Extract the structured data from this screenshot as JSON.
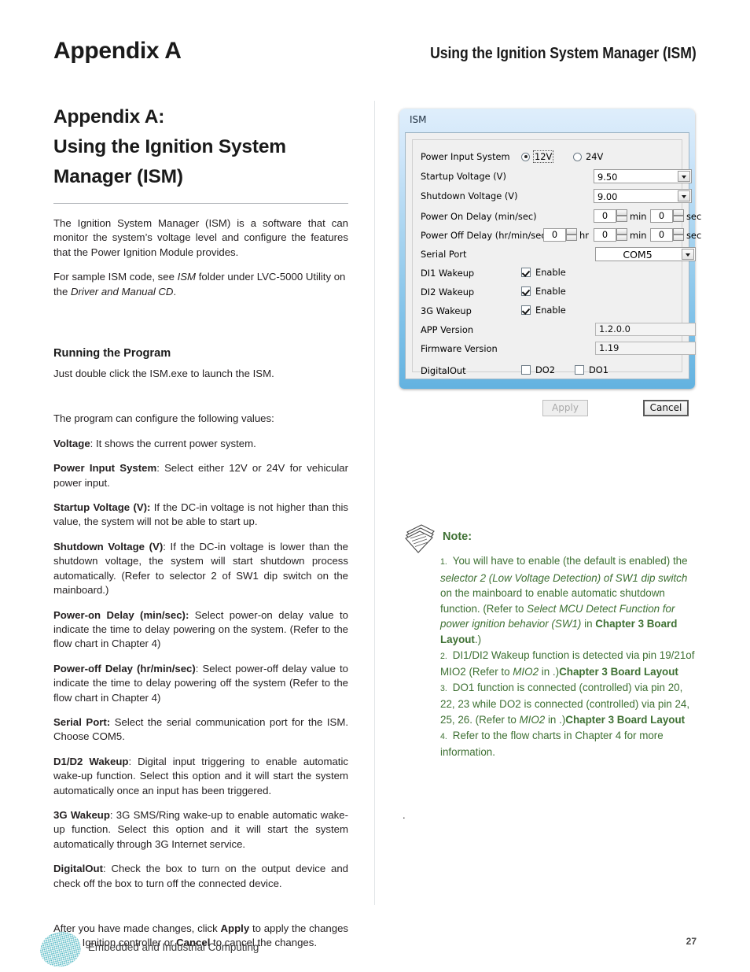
{
  "header": {
    "chapter_title": "Appendix A",
    "running_head": "Using the Ignition System Manager (ISM)"
  },
  "left_column": {
    "section_title_line1": "Appendix A:",
    "section_title_line2": "Using the Ignition System",
    "section_title_line3": "Manager (ISM)",
    "intro_paragraph": "The Ignition System Manager (ISM) is a software that can monitor the system’s voltage level and configure the features that the Power Ignition Module provides.",
    "sample_code_pre": "For sample ISM code, see ",
    "sample_code_em1": "ISM",
    "sample_code_mid": " folder under LVC-5000 Utility on the ",
    "sample_code_em2": "Driver and Manual CD",
    "sample_code_post": ".",
    "running_heading": "Running the Program",
    "running_text": "Just double click the ISM.exe to launch the ISM.",
    "configure_intro": "The program can configure the following values:",
    "definitions": [
      {
        "term": "Voltage",
        "sep": ": ",
        "text": "It shows the current power system."
      },
      {
        "term": "Power Input System",
        "sep": ": ",
        "text": "Select either 12V or 24V for vehicular power input."
      },
      {
        "term": "Startup Voltage (V):",
        "sep": "  ",
        "text": "If the DC-in voltage is not higher than this value, the system will not be able to start up."
      },
      {
        "term": "Shutdown Voltage (V)",
        "sep": ": ",
        "text": "If the DC-in voltage is lower than the shutdown voltage, the system will start shutdown process automatically. (Refer to selector 2 of SW1 dip switch on the mainboard.)"
      },
      {
        "term": "Power-on Delay (min/sec):",
        "sep": " ",
        "text": "Select power-on delay value to indicate the time to delay powering on the system. (Refer to the flow chart in Chapter 4)"
      },
      {
        "term": "Power-off Delay (hr/min/sec)",
        "sep": ": ",
        "text": "Select power-off delay value to indicate the time to delay powering off the system (Refer to the flow chart in Chapter 4)"
      },
      {
        "term": "Serial Port:",
        "sep": " ",
        "text": "Select the serial communication port for the ISM. Choose COM5."
      },
      {
        "term": "D1/D2 Wakeup",
        "sep": ": ",
        "text": "Digital input triggering to enable automatic wake-up function. Select this option and it will start the system automatically once an input has been triggered."
      },
      {
        "term": "3G Wakeup",
        "sep": ": ",
        "text": "3G SMS/Ring wake-up to enable automatic wake-up function.  Select this option and it will start the system automatically through 3G Internet service."
      },
      {
        "term": "DigitalOut",
        "sep": ":  ",
        "text": "Check the box to turn on the output device and check off the box to turn off the connected device."
      }
    ],
    "closing_pre": "After you have made changes, click ",
    "closing_b1": "Apply",
    "closing_mid": " to apply the changes to the Ignition controller or ",
    "closing_b2": "Cancel",
    "closing_post": " to cancel the changes."
  },
  "ism_dialog": {
    "title": "ISM",
    "rows": {
      "power_input_label": "Power Input System",
      "radio_12v": "12V",
      "radio_24v": "24V",
      "startup_voltage_label": "Startup Voltage (V)",
      "startup_voltage_value": "9.50",
      "shutdown_voltage_label": "Shutdown Voltage (V)",
      "shutdown_voltage_value": "9.00",
      "power_on_delay_label": "Power On Delay (min/sec)",
      "power_on_min": "0",
      "power_on_min_unit": "min",
      "power_on_sec": "0",
      "power_on_sec_unit": "sec",
      "power_off_delay_label": "Power Off Delay (hr/min/sec)",
      "power_off_hr": "0",
      "power_off_hr_unit": "hr",
      "power_off_min": "0",
      "power_off_min_unit": "min",
      "power_off_sec": "0",
      "power_off_sec_unit": "sec",
      "serial_port_label": "Serial Port",
      "serial_port_value": "COM5",
      "di1_wakeup_label": "DI1 Wakeup",
      "di1_wakeup_enable": "Enable",
      "di2_wakeup_label": "DI2 Wakeup",
      "di2_wakeup_enable": "Enable",
      "g3_wakeup_label": "3G Wakeup",
      "g3_wakeup_enable": "Enable",
      "app_version_label": "APP Version",
      "app_version_value": "1.2.0.0",
      "firmware_version_label": "Firmware Version",
      "firmware_version_value": "1.19",
      "digitalout_label": "DigitalOut",
      "do2_label": "DO2",
      "do1_label": "DO1"
    },
    "buttons": {
      "apply": "Apply",
      "cancel": "Cancel"
    }
  },
  "note": {
    "heading": "Note:",
    "items": [
      {
        "num": "1.",
        "p1": "You will have to enable (the default is enabled) the ",
        "em1": "selector 2 (Low Voltage Detection) of SW1 dip switch",
        "p2": " on the mainboard to enable automatic shutdown function. (Refer to ",
        "em2": "Select MCU Detect Function for power ignition behavior (SW1)",
        "p3": " in ",
        "b1": "Chapter 3 Board Layout",
        "p4": ".)"
      },
      {
        "num": "2.",
        "p1": "DI1/DI2 Wakeup function is detected via pin 19/21of MIO2 (Refer to ",
        "em1": "MIO2",
        "p2": " in ",
        "b1": "Chapter 3 Board Layout",
        "p3": ".)"
      },
      {
        "num": "3.",
        "p1": "DO1 function is connected (controlled) via pin 20, 22, 23 while DO2 is connected (controlled) via pin 24, 25, 26. (Refer to ",
        "em1": "MIO2",
        "p2": " in ",
        "b1": "Chapter 3 Board Layout",
        "p3": ".)"
      },
      {
        "num": "4.",
        "p1": "Refer to the flow charts in Chapter 4 for more information."
      }
    ],
    "trailing_dot": "."
  },
  "footer": {
    "tagline": "Embedded and Industrial Computing",
    "page_number": "27"
  },
  "colors": {
    "note_green": "#3e7033",
    "logo_teal": "#12a0ac",
    "dialog_blue": "#7cc0e8"
  }
}
